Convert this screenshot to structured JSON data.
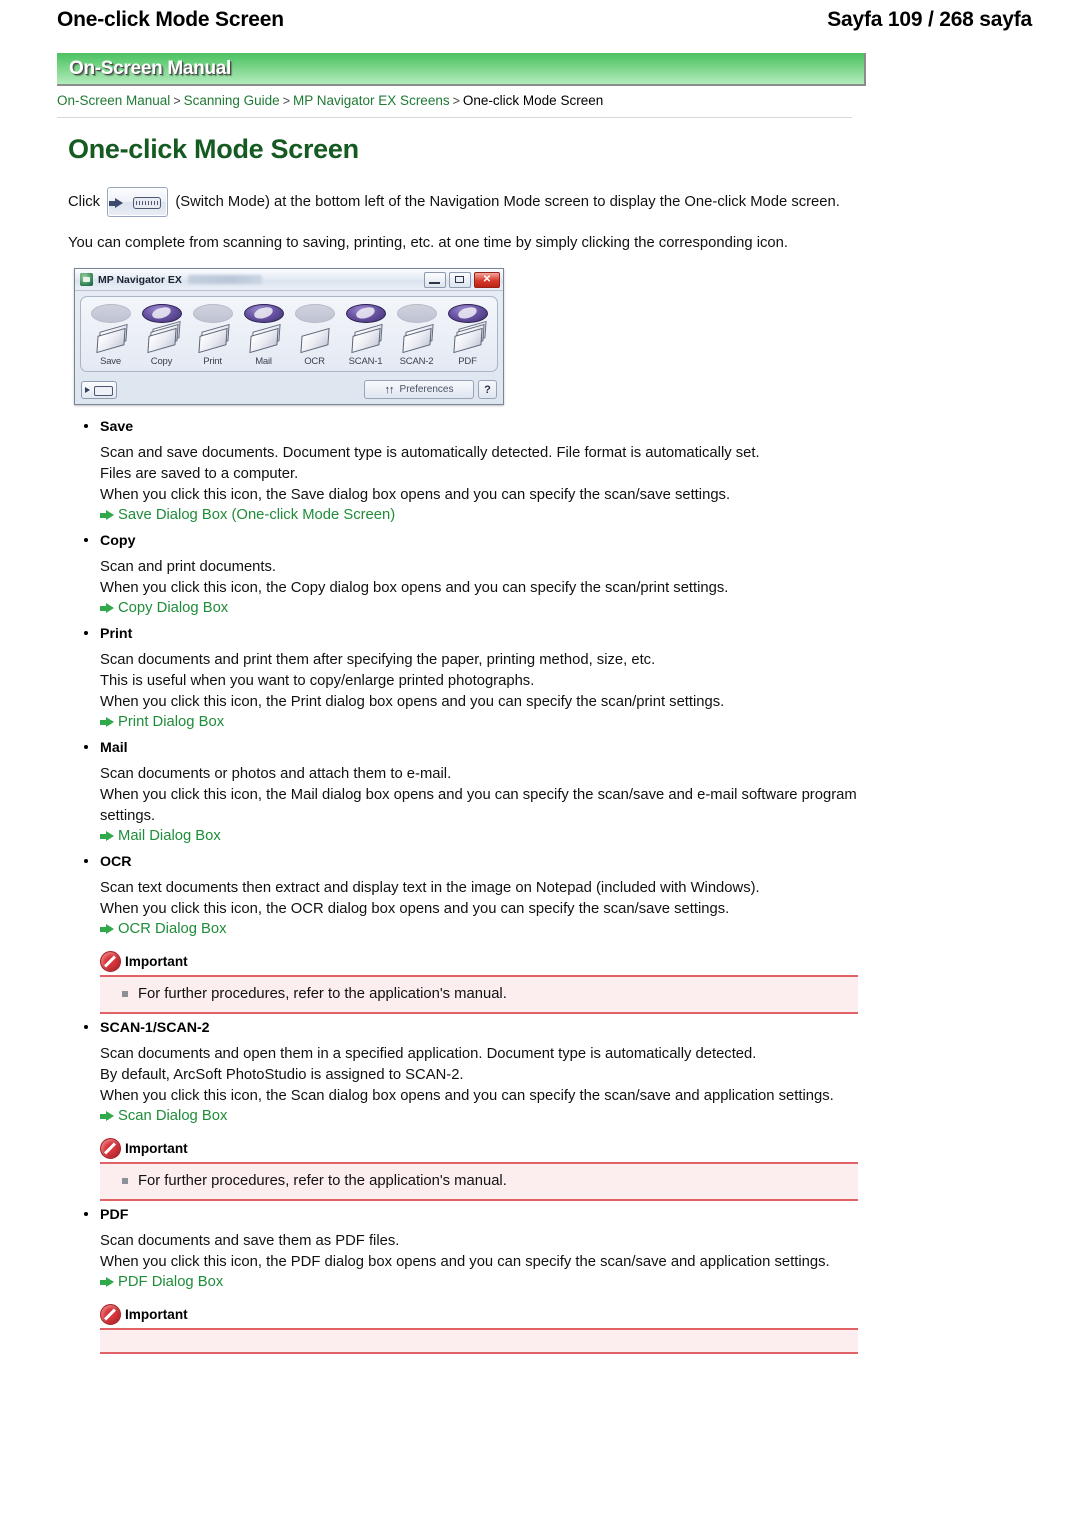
{
  "header": {
    "doc_title": "One-click Mode Screen",
    "page_label": "Sayfa 109 / 268 sayfa"
  },
  "banner": {
    "title": "On-Screen Manual"
  },
  "breadcrumb": {
    "items": [
      {
        "label": "On-Screen Manual",
        "link": true
      },
      {
        "label": "Scanning Guide",
        "link": true
      },
      {
        "label": "MP Navigator EX Screens",
        "link": true
      },
      {
        "label": "One-click Mode Screen",
        "link": false
      }
    ],
    "separator": ">"
  },
  "main": {
    "title": "One-click Mode Screen",
    "intro_before_icon": "Click",
    "intro_after_icon": "(Switch Mode) at the bottom left of the Navigation Mode screen to display the One-click Mode screen.",
    "intro_second": "You can complete from scanning to saving, printing, etc. at one time by simply clicking the corresponding icon."
  },
  "mpnav_window": {
    "app_title": "MP Navigator EX",
    "minimize_tooltip": "Minimize",
    "maximize_tooltip": "Maximize",
    "close_tooltip": "Close",
    "close_glyph": "✕",
    "icons": [
      {
        "label": "Save",
        "oval": "gray",
        "glyph": "⬇"
      },
      {
        "label": "Copy",
        "oval": "purple",
        "glyph": ""
      },
      {
        "label": "Print",
        "oval": "gray",
        "glyph": ""
      },
      {
        "label": "Mail",
        "oval": "purple",
        "glyph": ""
      },
      {
        "label": "OCR",
        "oval": "gray",
        "glyph": ""
      },
      {
        "label": "SCAN-1",
        "oval": "purple",
        "glyph": ""
      },
      {
        "label": "SCAN-2",
        "oval": "gray",
        "glyph": ""
      },
      {
        "label": "PDF",
        "oval": "purple",
        "glyph": ""
      }
    ],
    "preferences_label": "Preferences",
    "tools_glyph": "↑↑",
    "help_label": "?"
  },
  "sections": [
    {
      "name": "save",
      "heading": "Save",
      "lines": [
        "Scan and save documents. Document type is automatically detected. File format is automatically set.",
        "Files are saved to a computer.",
        "When you click this icon, the Save dialog box opens and you can specify the scan/save settings."
      ],
      "link": "Save Dialog Box (One-click Mode Screen)",
      "important": null
    },
    {
      "name": "copy",
      "heading": "Copy",
      "lines": [
        "Scan and print documents.",
        "When you click this icon, the Copy dialog box opens and you can specify the scan/print settings."
      ],
      "link": "Copy Dialog Box",
      "important": null
    },
    {
      "name": "print",
      "heading": "Print",
      "lines": [
        "Scan documents and print them after specifying the paper, printing method, size, etc.",
        "This is useful when you want to copy/enlarge printed photographs.",
        "When you click this icon, the Print dialog box opens and you can specify the scan/print settings."
      ],
      "link": "Print Dialog Box",
      "important": null
    },
    {
      "name": "mail",
      "heading": "Mail",
      "lines": [
        "Scan documents or photos and attach them to e-mail.",
        "When you click this icon, the Mail dialog box opens and you can specify the scan/save and e-mail software program settings."
      ],
      "link": "Mail Dialog Box",
      "important": null
    },
    {
      "name": "ocr",
      "heading": "OCR",
      "lines": [
        "Scan text documents then extract and display text in the image on Notepad (included with Windows).",
        "When you click this icon, the OCR dialog box opens and you can specify the scan/save settings."
      ],
      "link": "OCR Dialog Box",
      "important": {
        "label": "Important",
        "items": [
          "For further procedures, refer to the application's manual."
        ]
      }
    },
    {
      "name": "scan",
      "heading": "SCAN-1/SCAN-2",
      "lines": [
        "Scan documents and open them in a specified application. Document type is automatically detected.",
        "By default, ArcSoft PhotoStudio is assigned to SCAN-2.",
        "When you click this icon, the Scan dialog box opens and you can specify the scan/save and application settings."
      ],
      "link": "Scan Dialog Box",
      "important": {
        "label": "Important",
        "items": [
          "For further procedures, refer to the application's manual."
        ]
      }
    },
    {
      "name": "pdf",
      "heading": "PDF",
      "lines": [
        "Scan documents and save them as PDF files.",
        "When you click this icon, the PDF dialog box opens and you can specify the scan/save and application settings."
      ],
      "link": "PDF Dialog Box",
      "important": {
        "label": "Important",
        "items": []
      }
    }
  ],
  "colors": {
    "banner_green_top": "#4fc264",
    "banner_green_bottom": "#b4ebbd",
    "title_green": "#145a21",
    "link_green": "#1f8c39",
    "important_red": "#e06166",
    "important_bg": "#fceeef"
  }
}
